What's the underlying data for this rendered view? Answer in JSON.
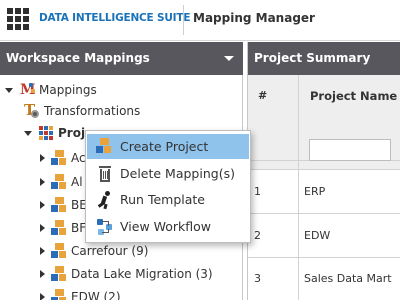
{
  "app": {
    "brand": "DATA INTELLIGENCE SUITE",
    "title": "Mapping Manager"
  },
  "left_panel": {
    "title": "Workspace Mappings",
    "tree": {
      "root": "Mappings",
      "transformations": "Transformations",
      "projects_partial": "Projec",
      "children": [
        {
          "label": "Ac"
        },
        {
          "label": "Al"
        },
        {
          "label": "BE"
        },
        {
          "label": "BF"
        },
        {
          "label": "Carrefour (9)"
        },
        {
          "label": "Data Lake Migration (3)"
        },
        {
          "label": "EDW (2)"
        }
      ]
    }
  },
  "right_panel": {
    "title": "Project Summary",
    "columns": [
      "#",
      "Project Name"
    ],
    "filter_value": "",
    "rows": [
      {
        "num": "1",
        "name": "ERP"
      },
      {
        "num": "2",
        "name": "EDW"
      },
      {
        "num": "3",
        "name": "Sales Data Mart"
      }
    ]
  },
  "context_menu": {
    "items": [
      {
        "label": "Create Project",
        "icon": "create-project-icon",
        "active": true
      },
      {
        "label": "Delete Mapping(s)",
        "icon": "trash-icon",
        "active": false
      },
      {
        "label": "Run Template",
        "icon": "run-icon",
        "active": false
      },
      {
        "label": "View Workflow",
        "icon": "workflow-icon",
        "active": false
      }
    ]
  },
  "colors": {
    "brand_blue": "#1a73b8",
    "panel_header": "#57575d",
    "menu_highlight": "#8fc3ec",
    "icon_orange": "#e8a33c",
    "icon_blue": "#2b6cb8"
  }
}
